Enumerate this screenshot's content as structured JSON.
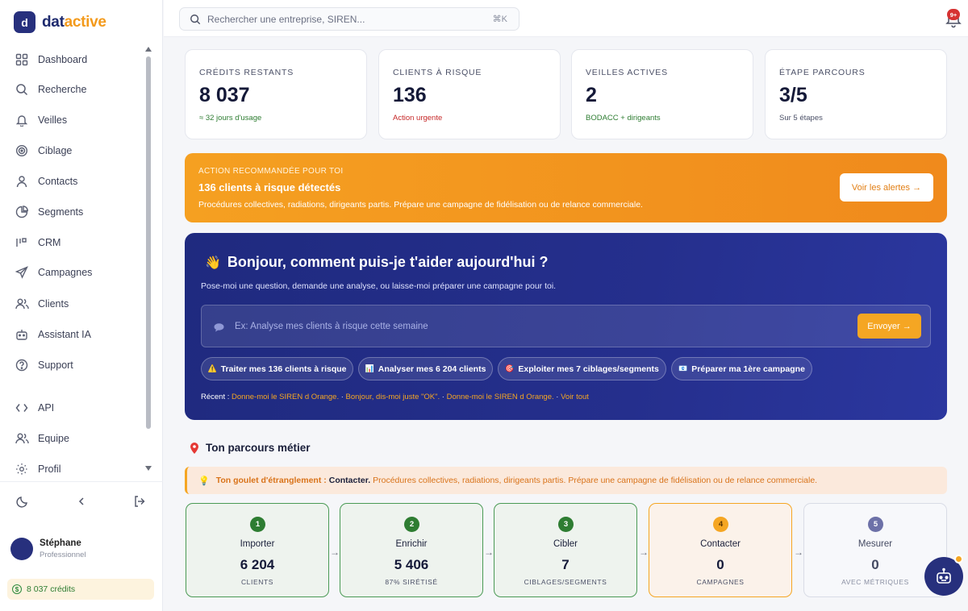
{
  "brand": {
    "mark": "d",
    "name_a": "dat",
    "name_b": "active"
  },
  "sidebar": {
    "items": [
      {
        "label": "Dashboard",
        "icon": "grid-icon"
      },
      {
        "label": "Recherche",
        "icon": "search-icon"
      },
      {
        "label": "Veilles",
        "icon": "bell-icon"
      },
      {
        "label": "Ciblage",
        "icon": "target-icon"
      },
      {
        "label": "Contacts",
        "icon": "user-icon"
      },
      {
        "label": "Segments",
        "icon": "pie-icon"
      },
      {
        "label": "CRM",
        "icon": "bars-icon"
      },
      {
        "label": "Campagnes",
        "icon": "send-icon"
      },
      {
        "label": "Clients",
        "icon": "users-icon"
      },
      {
        "label": "Assistant IA",
        "icon": "robot-icon"
      },
      {
        "label": "Support",
        "icon": "help-icon"
      },
      {
        "label": "API",
        "icon": "code-icon"
      },
      {
        "label": "Equipe",
        "icon": "team-icon"
      },
      {
        "label": "Profil",
        "icon": "settings-icon"
      }
    ],
    "user": {
      "name": "Stéphane",
      "role": "Professionnel"
    },
    "credits": "8 037 crédits"
  },
  "topbar": {
    "search_placeholder": "Rechercher une entreprise, SIREN...",
    "shortcut": "⌘K",
    "notif_badge": "9+"
  },
  "stats": [
    {
      "label": "CRÉDITS RESTANTS",
      "value": "8 037",
      "sub": "≈ 32 jours d'usage",
      "sub_color": "#2e7d32"
    },
    {
      "label": "CLIENTS À RISQUE",
      "value": "136",
      "sub": "Action urgente",
      "sub_color": "#c62828"
    },
    {
      "label": "VEILLES ACTIVES",
      "value": "2",
      "sub": "BODACC + dirigeants",
      "sub_color": "#2e7d32"
    },
    {
      "label": "ÉTAPE PARCOURS",
      "value": "3/5",
      "sub": "Sur 5 étapes",
      "sub_color": "#4c5168"
    }
  ],
  "banner": {
    "kicker": "ACTION RECOMMANDÉE POUR TOI",
    "title": "136 clients à risque détectés",
    "desc": "Procédures collectives, radiations, dirigeants partis. Prépare une campagne de fidélisation ou de relance commerciale.",
    "button": "Voir les alertes →"
  },
  "assistant": {
    "greeting": "Bonjour, comment puis-je t'aider aujourd'hui ?",
    "wave": "👋",
    "sub": "Pose-moi une question, demande une analyse, ou laisse-moi préparer une campagne pour toi.",
    "placeholder": "Ex: Analyse mes clients à risque cette semaine",
    "send": "Envoyer →",
    "chips": [
      {
        "emoji": "⚠️",
        "label": "Traiter mes 136 clients à risque"
      },
      {
        "emoji": "📊",
        "label": "Analyser mes 6 204 clients"
      },
      {
        "emoji": "🎯",
        "label": "Exploiter mes 7 ciblages/segments"
      },
      {
        "emoji": "📧",
        "label": "Préparer ma 1ère campagne"
      }
    ],
    "recent_label": "Récent :",
    "recent": [
      "Donne-moi le SIREN d Orange.",
      "Bonjour, dis-moi juste \"OK\".",
      "Donne-moi le SIREN d Orange.",
      "Voir tout"
    ]
  },
  "parcours": {
    "title": "Ton parcours métier",
    "alert_key": "Ton goulet d'étranglement :",
    "alert_value": "Contacter.",
    "alert_desc": "Procédures collectives, radiations, dirigeants partis. Prépare une campagne de fidélisation ou de relance commerciale.",
    "steps": [
      {
        "num": "1",
        "name": "Importer",
        "value": "6 204",
        "caption": "CLIENTS"
      },
      {
        "num": "2",
        "name": "Enrichir",
        "value": "5 406",
        "caption": "87% SIRÉTISÉ"
      },
      {
        "num": "3",
        "name": "Cibler",
        "value": "7",
        "caption": "CIBLAGES/SEGMENTS"
      },
      {
        "num": "4",
        "name": "Contacter",
        "value": "0",
        "caption": "CAMPAGNES"
      },
      {
        "num": "5",
        "name": "Mesurer",
        "value": "0",
        "caption": "AVEC MÉTRIQUES"
      }
    ],
    "arrow": "→"
  }
}
